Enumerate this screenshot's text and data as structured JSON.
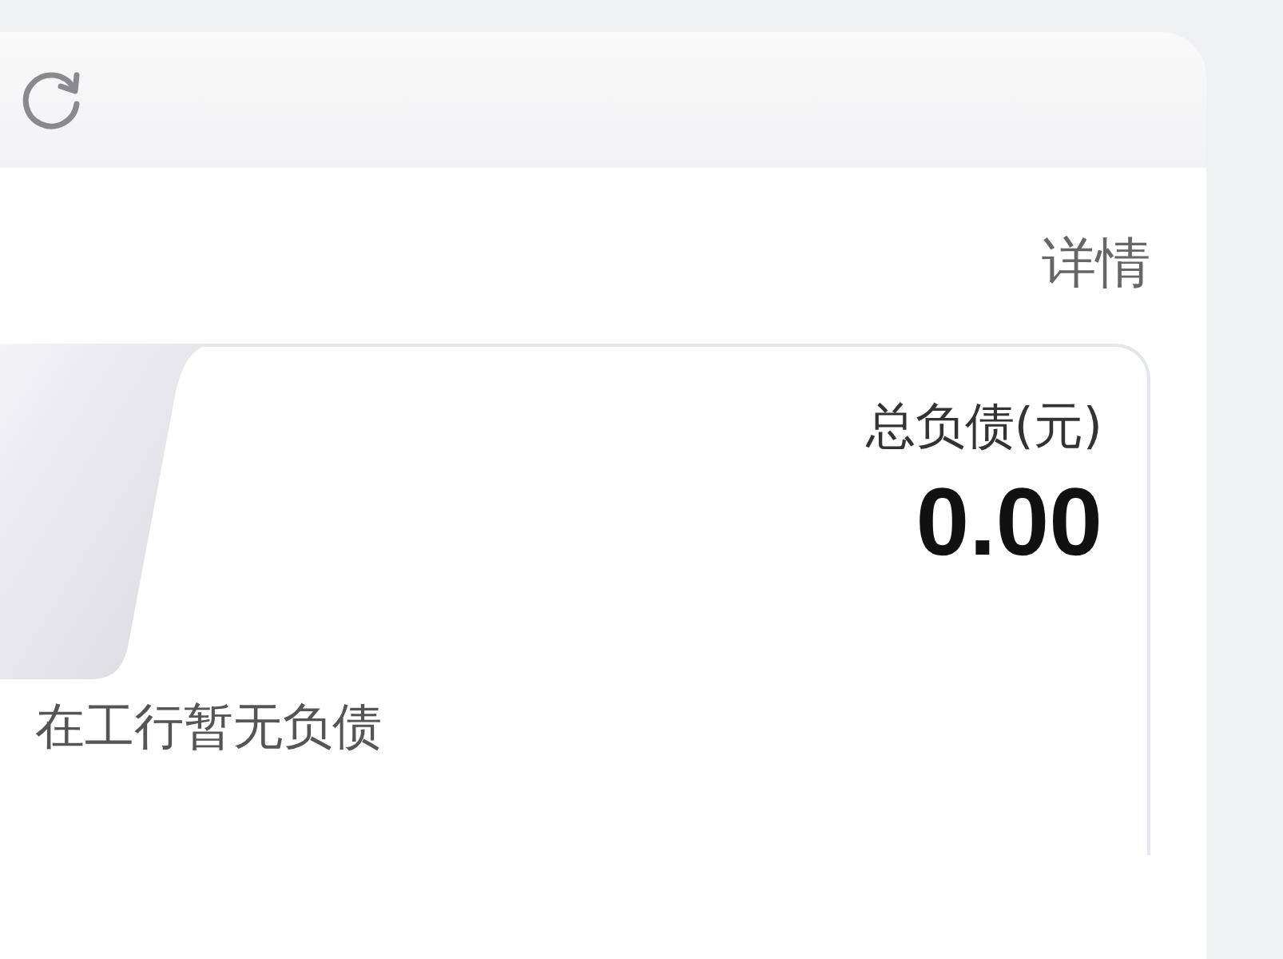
{
  "panel": {
    "link": "详情",
    "debt_card": {
      "label": "总负债(元)",
      "amount": "0.00"
    },
    "message": "在工行暂无负债"
  }
}
